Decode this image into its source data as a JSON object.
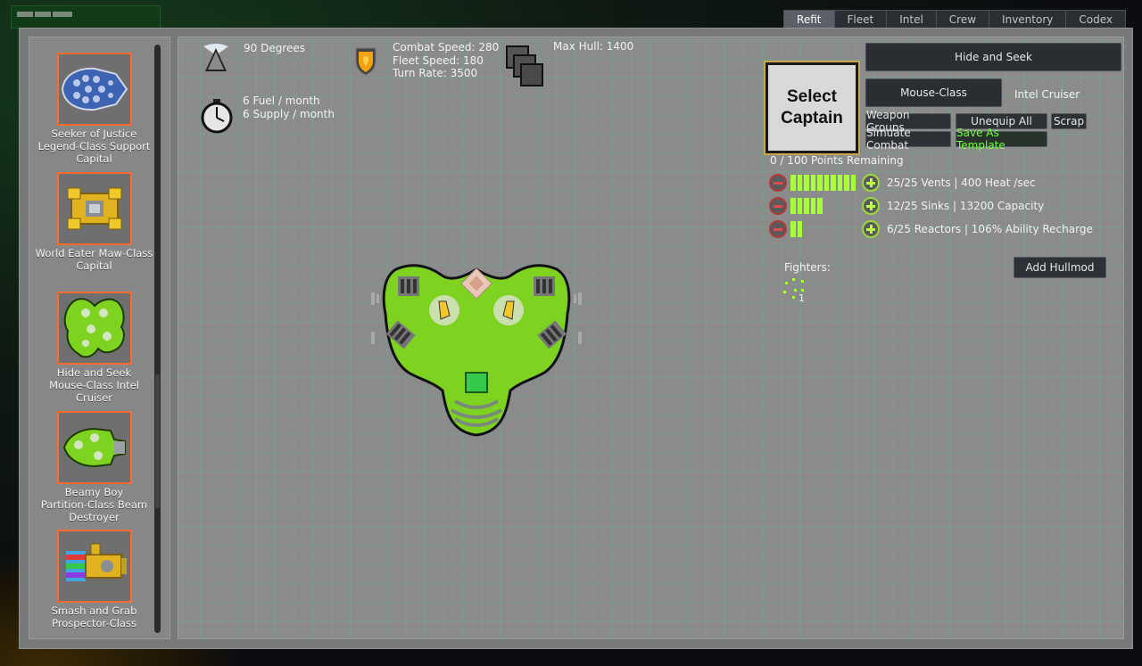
{
  "tabs": [
    {
      "label": "Refit",
      "active": true
    },
    {
      "label": "Fleet",
      "active": false
    },
    {
      "label": "Intel",
      "active": false
    },
    {
      "label": "Crew",
      "active": false
    },
    {
      "label": "Inventory",
      "active": false
    },
    {
      "label": "Codex",
      "active": false
    }
  ],
  "fleet_list": [
    {
      "name_lines": [
        "Seeker of Justice",
        "Legend-Class Support",
        "Capital"
      ],
      "icon": "legend-ship-icon"
    },
    {
      "name_lines": [
        "World Eater Maw-Class",
        "Capital"
      ],
      "icon": "maw-ship-icon"
    },
    {
      "name_lines": [
        "Hide and Seek",
        "Mouse-Class Intel",
        "Cruiser"
      ],
      "icon": "mouse-ship-icon"
    },
    {
      "name_lines": [
        "Beamy Boy",
        "Partition-Class Beam",
        "Destroyer"
      ],
      "icon": "partition-ship-icon"
    },
    {
      "name_lines": [
        "Smash and Grab",
        "Prospector-Class"
      ],
      "icon": "prospector-ship-icon"
    }
  ],
  "stats": {
    "sensor": "90 Degrees",
    "fuel": "6 Fuel / month",
    "supply": "6 Supply / month",
    "combat_speed": "Combat Speed: 280",
    "fleet_speed": "Fleet Speed: 180",
    "turn_rate": "Turn Rate: 3500",
    "max_hull": "Max Hull: 1400"
  },
  "captain": {
    "line1": "Select",
    "line2": "Captain"
  },
  "ship": {
    "name": "Hide and Seek",
    "class": "Mouse-Class",
    "type": "Intel Cruiser"
  },
  "buttons": {
    "weapon_groups": "Weapon Groups",
    "unequip_all": "Unequip All",
    "scrap": "Scrap",
    "simulate_combat": "Simuate Combat",
    "save_template": "Save As Template",
    "add_hullmod": "Add Hullmod"
  },
  "points": "0 / 100 Points Remaining",
  "flux": [
    {
      "label": "25/25 Vents | 400 Heat /sec",
      "filled": 25,
      "max": 25
    },
    {
      "label": "12/25 Sinks | 13200 Capacity",
      "filled": 12,
      "max": 25
    },
    {
      "label": "6/25 Reactors | 106% Ability Recharge",
      "filled": 6,
      "max": 25
    }
  ],
  "fighters": {
    "label": "Fighters:",
    "count": "1"
  },
  "colors": {
    "hull_green": "#7ed321",
    "accent_orange": "#ff6a2f",
    "bar_green": "#a8ff3a"
  }
}
